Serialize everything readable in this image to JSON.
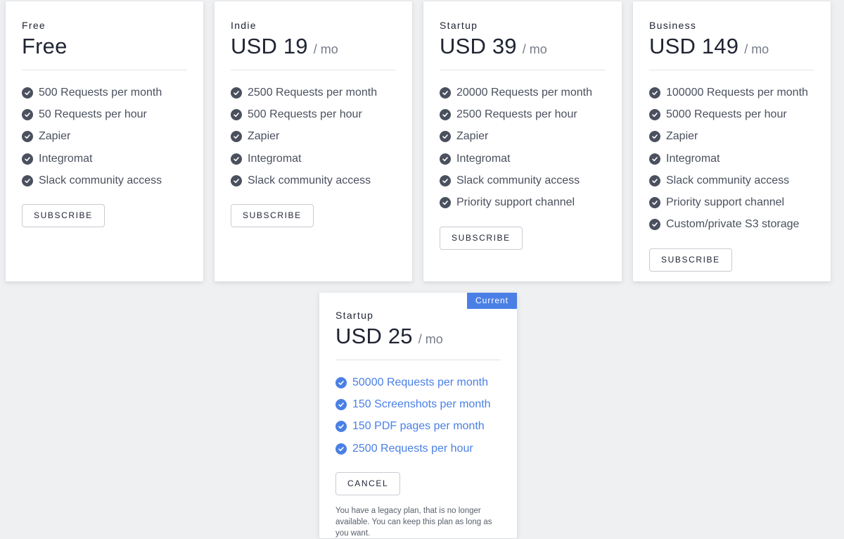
{
  "plans": [
    {
      "name": "Free",
      "price": "Free",
      "period": "",
      "features": [
        "500 Requests per month",
        "50 Requests per hour",
        "Zapier",
        "Integromat",
        "Slack community access"
      ],
      "button_label": "SUBSCRIBE"
    },
    {
      "name": "Indie",
      "price": "USD 19",
      "period": "/ mo",
      "features": [
        "2500 Requests per month",
        "500 Requests per hour",
        "Zapier",
        "Integromat",
        "Slack community access"
      ],
      "button_label": "SUBSCRIBE"
    },
    {
      "name": "Startup",
      "price": "USD 39",
      "period": "/ mo",
      "features": [
        "20000 Requests per month",
        "2500 Requests per hour",
        "Zapier",
        "Integromat",
        "Slack community access",
        "Priority support channel"
      ],
      "button_label": "SUBSCRIBE"
    },
    {
      "name": "Business",
      "price": "USD 149",
      "period": "/ mo",
      "features": [
        "100000 Requests per month",
        "5000 Requests per hour",
        "Zapier",
        "Integromat",
        "Slack community access",
        "Priority support channel",
        "Custom/private S3 storage"
      ],
      "button_label": "SUBSCRIBE"
    }
  ],
  "current_plan": {
    "badge": "Current",
    "name": "Startup",
    "price": "USD 25",
    "period": "/ mo",
    "features": [
      "50000 Requests per month",
      "150 Screenshots per month",
      "150 PDF pages per month",
      "2500 Requests per hour"
    ],
    "button_label": "CANCEL",
    "note": "You have a legacy plan, that is no longer available. You can keep this plan as long as you want."
  },
  "icons": {
    "feature": "check-circle-icon"
  },
  "colors": {
    "accent": "#4a80e6",
    "check": "#4a505e",
    "background": "#eff0f2"
  }
}
